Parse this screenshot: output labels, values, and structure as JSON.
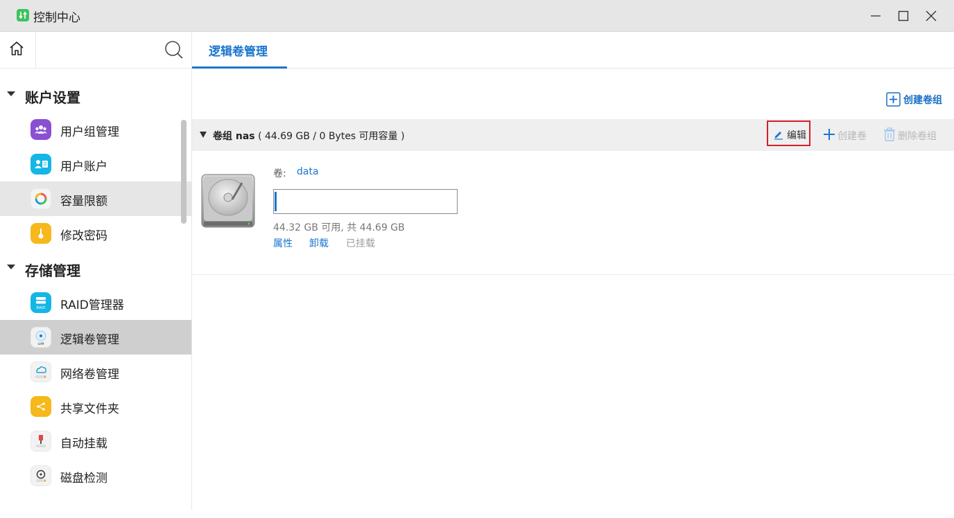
{
  "window": {
    "title": "控制中心",
    "minimize_icon": "minimize-icon",
    "maximize_icon": "maximize-icon",
    "close_icon": "close-icon"
  },
  "sidebar": {
    "sections": [
      {
        "label": "账户设置",
        "items": [
          {
            "label": "用户组管理",
            "icon": "user-group-icon",
            "state": "normal"
          },
          {
            "label": "用户账户",
            "icon": "user-account-icon",
            "state": "normal"
          },
          {
            "label": "容量限额",
            "icon": "quota-icon",
            "state": "hover"
          },
          {
            "label": "修改密码",
            "icon": "password-icon",
            "state": "normal"
          }
        ]
      },
      {
        "label": "存储管理",
        "items": [
          {
            "label": "RAID管理器",
            "icon": "raid-icon",
            "state": "normal"
          },
          {
            "label": "逻辑卷管理",
            "icon": "lvm-icon",
            "state": "active"
          },
          {
            "label": "网络卷管理",
            "icon": "network-volume-icon",
            "state": "normal"
          },
          {
            "label": "共享文件夹",
            "icon": "shared-folder-icon",
            "state": "normal"
          },
          {
            "label": "自动挂载",
            "icon": "auto-mount-icon",
            "state": "normal"
          },
          {
            "label": "磁盘检测",
            "icon": "disk-check-icon",
            "state": "normal"
          }
        ]
      }
    ],
    "raid_icon_text": "RAID",
    "lvm_icon_text": "LVM"
  },
  "main": {
    "tab_label": "逻辑卷管理",
    "create_group_label": "创建卷组",
    "volume_group": {
      "prefix": "卷组",
      "name": "nas",
      "details": " ( 44.69 GB / 0 Bytes 可用容量 )",
      "edit_label": "编辑",
      "create_volume_label": "创建卷",
      "delete_group_label": "删除卷组"
    },
    "volume": {
      "label": "卷:",
      "name": "data",
      "used_fraction": 0.008,
      "capacity_text": "44.32 GB 可用, 共 44.69 GB",
      "properties_label": "属性",
      "unmount_label": "卸载",
      "mounted_status": "已挂载"
    }
  },
  "colors": {
    "accent": "#1a75cf",
    "highlight_border": "#d21f2b",
    "disabled": "#b7b7b7"
  }
}
